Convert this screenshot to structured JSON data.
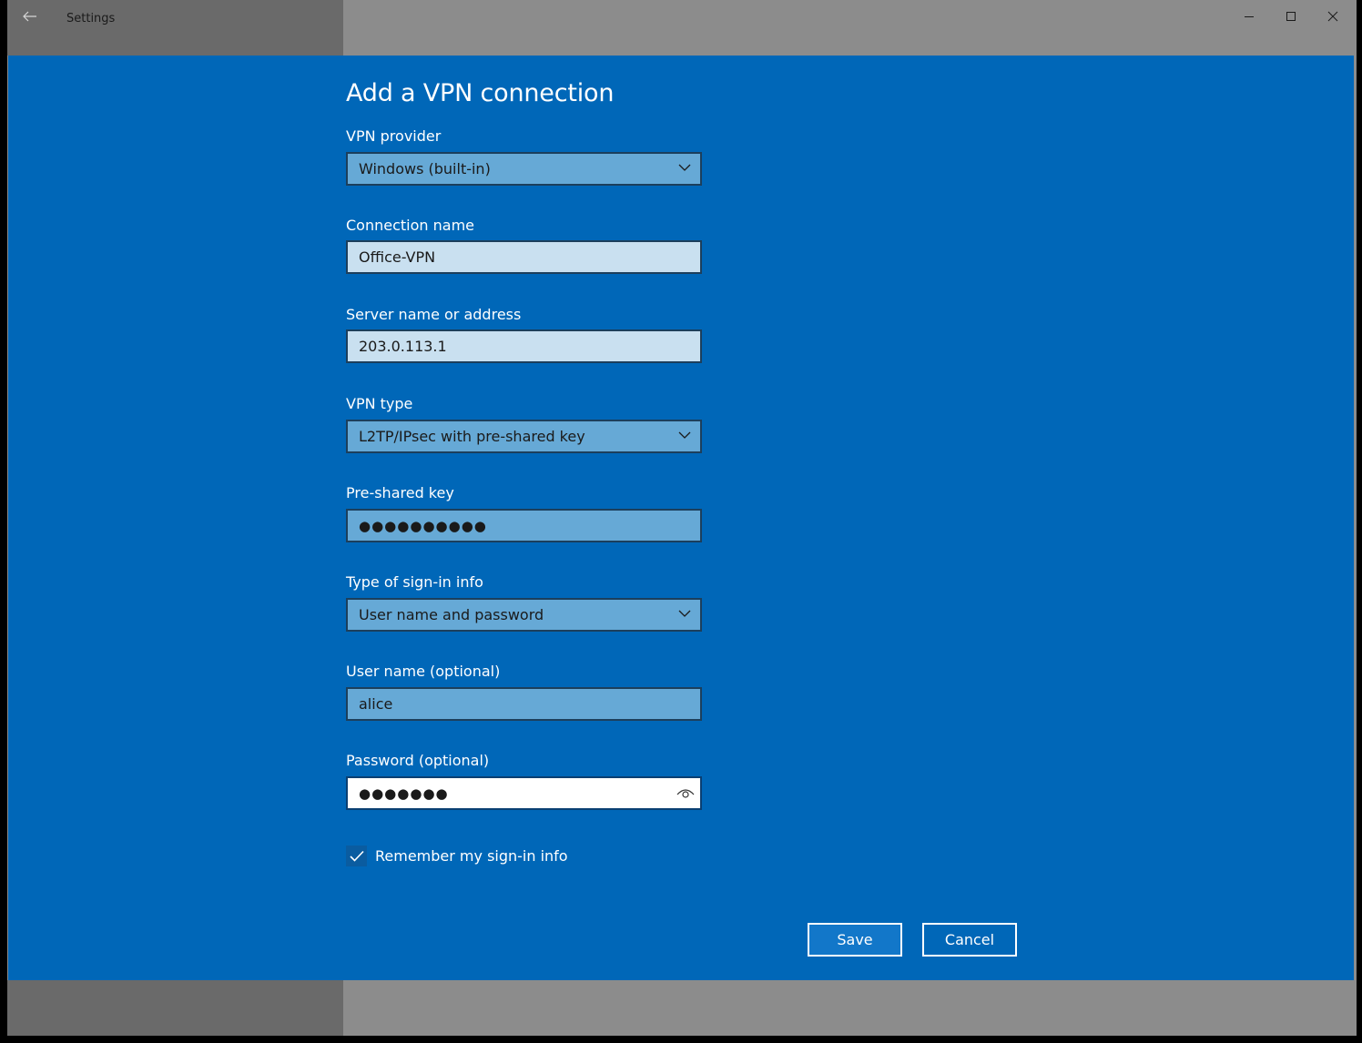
{
  "window": {
    "app_title": "Settings",
    "controls": {
      "minimize": "minimize-icon",
      "maximize": "maximize-icon",
      "close": "close-icon"
    }
  },
  "dialog": {
    "title": "Add a VPN connection",
    "vpn_provider": {
      "label": "VPN provider",
      "value": "Windows (built-in)"
    },
    "connection_name": {
      "label": "Connection name",
      "value": "Office-VPN"
    },
    "server": {
      "label": "Server name or address",
      "value": "203.0.113.1"
    },
    "vpn_type": {
      "label": "VPN type",
      "value": "L2TP/IPsec with pre-shared key"
    },
    "psk": {
      "label": "Pre-shared key",
      "value": "●●●●●●●●●●"
    },
    "signin_type": {
      "label": "Type of sign-in info",
      "value": "User name and password"
    },
    "username": {
      "label": "User name (optional)",
      "value": "alice"
    },
    "password": {
      "label": "Password (optional)",
      "value": "●●●●●●●"
    },
    "remember": {
      "label": "Remember my sign-in info",
      "checked": true
    },
    "buttons": {
      "save": "Save",
      "cancel": "Cancel"
    }
  },
  "colors": {
    "dialog_bg": "#0067b8",
    "field_select": "#66a9d6",
    "field_text": "#c9e0f0",
    "save_bg": "#1277c9"
  }
}
